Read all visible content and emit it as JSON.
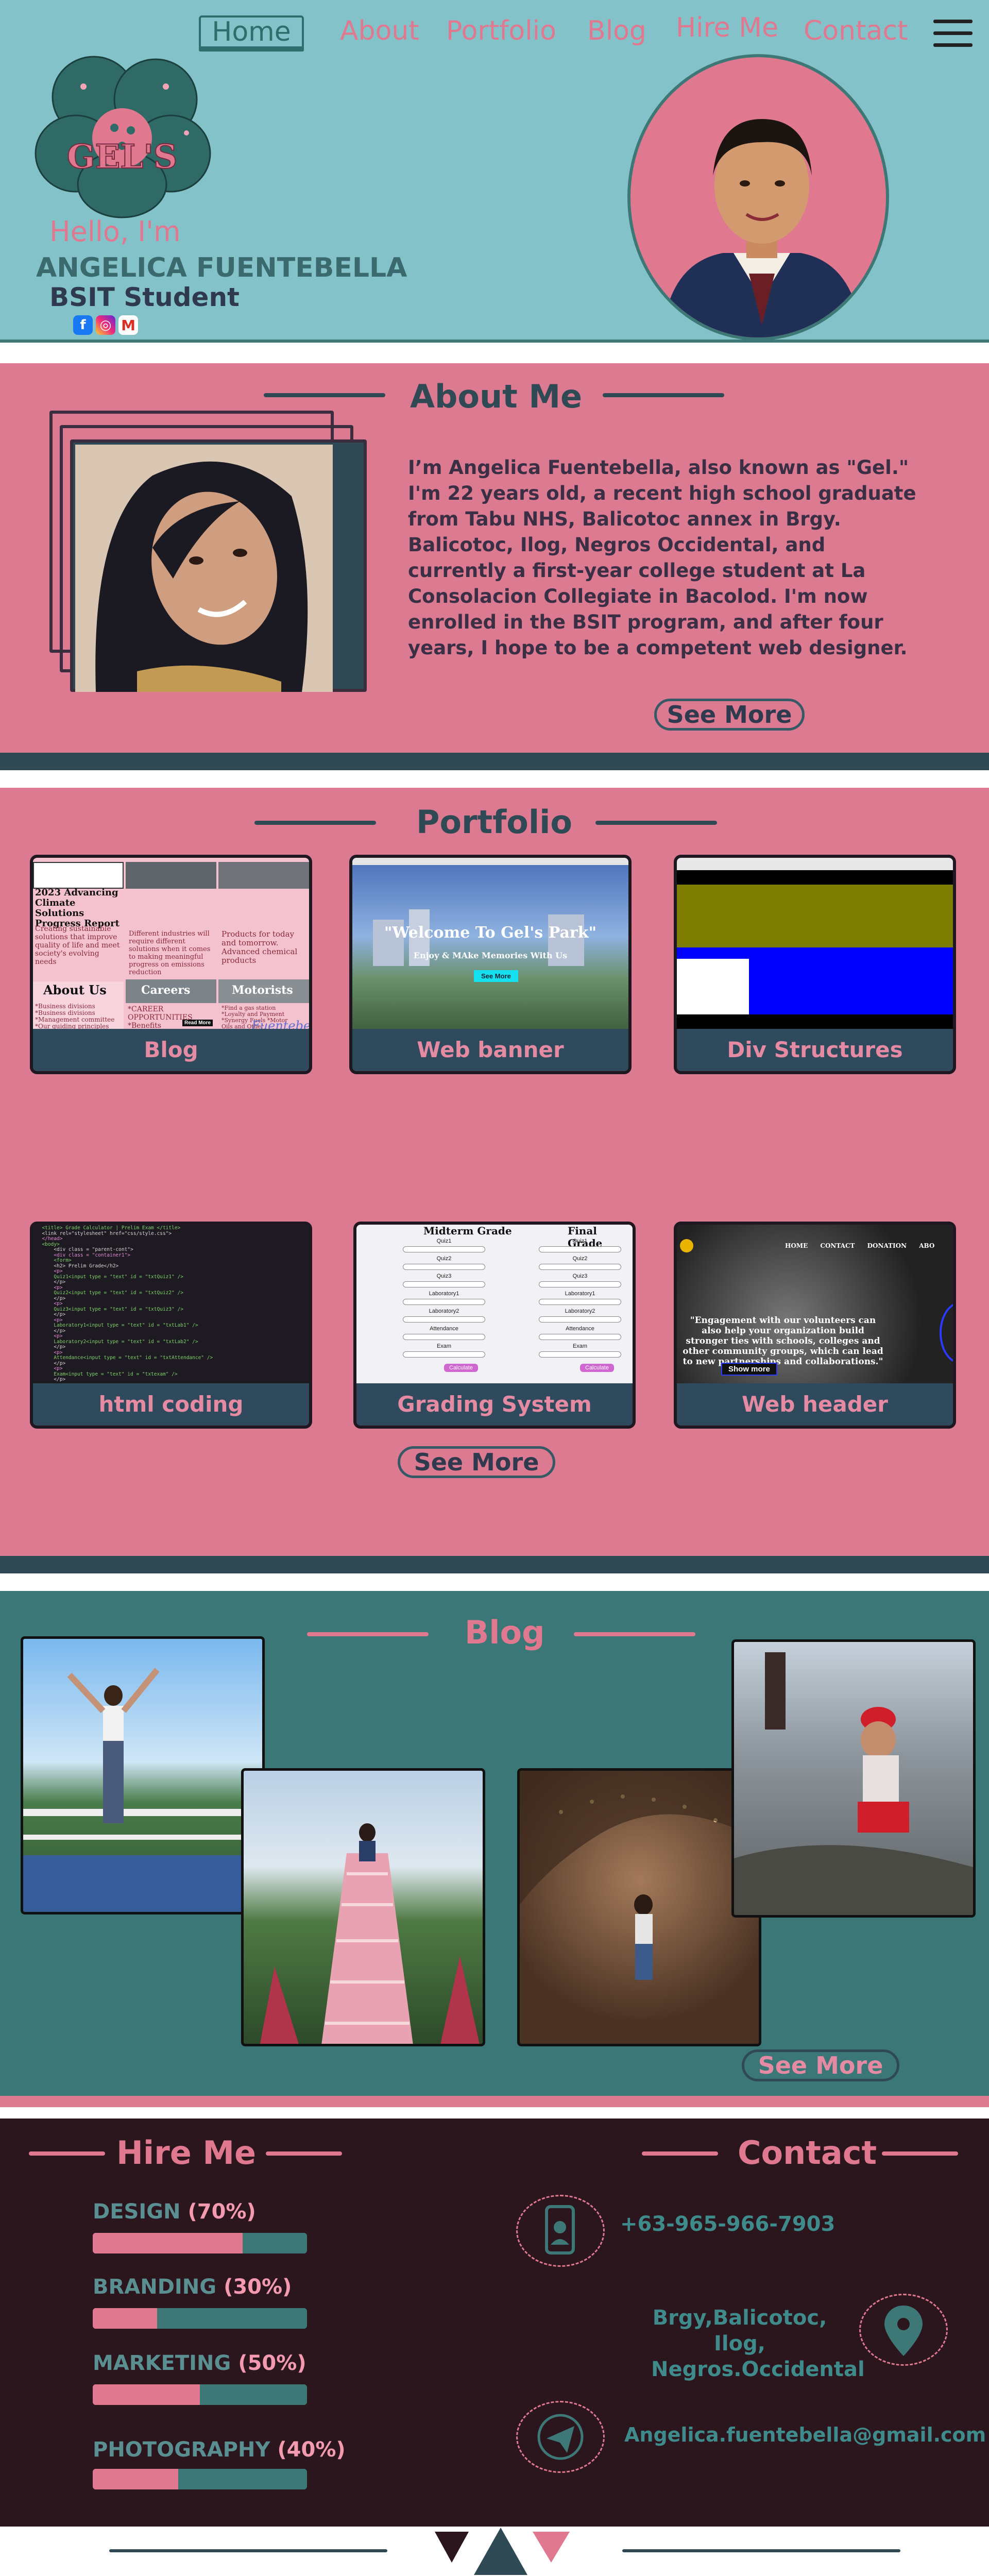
{
  "colors": {
    "hero_bg": "#84c2c9",
    "pink": "#dc7a91",
    "teal": "#3b7776",
    "dark": "#2b161e",
    "navy_strip": "#2f4a55"
  },
  "nav": {
    "home": "Home",
    "about": "About",
    "portfolio": "Portfolio",
    "blog": "Blog",
    "hire_me": "Hire Me",
    "contact": "Contact",
    "menu_icon": "hamburger-menu-icon"
  },
  "hero": {
    "logo_text": "GEL'S",
    "greeting": "Hello, I'm",
    "name": "ANGELICA FUENTEBELLA",
    "role": "BSIT Student",
    "social_icons": [
      "facebook-icon",
      "instagram-icon",
      "gmail-icon"
    ],
    "portrait_icon": "profile-portrait"
  },
  "about": {
    "title": "About Me",
    "text": "I’m Angelica Fuentebella, also known as \"Gel.\" I'm 22 years old, a recent high school graduate from Tabu NHS, Balicotoc annex in Brgy. Balicotoc, Ilog, Negros Occidental, and currently a first-year college student at La Consolacion Collegiate in Bacolod. I'm now enrolled in the BSIT program, and after four years, I hope to be a competent web designer.",
    "see_more": "See More"
  },
  "portfolio": {
    "title": "Portfolio",
    "items": [
      {
        "label": "Blog"
      },
      {
        "label": "Web banner"
      },
      {
        "label": "Div Structures"
      },
      {
        "label": "html coding"
      },
      {
        "label": "Grading System"
      },
      {
        "label": "Web header"
      }
    ],
    "see_more": "See More",
    "blog_thumb": {
      "col1_heading": "2023 Advancing Climate Solutions Progress Report",
      "col1_text": "Creating sustainable solutions that improve quality of life and meet society's evolving needs",
      "col2_text": "Different industries will require different solutions when it comes to making meaningful progress on emissions reduction",
      "col3_text": "Products for today and tomorrow. Advanced chemical products",
      "about_heading": "About Us",
      "careers_heading": "Careers",
      "motorists_heading": "Motorists",
      "about_list": "*Business divisions *Business divisions *Management committee *Our guiding principles",
      "careers_list": "*CAREER OPPORTUNITIES *Benefits",
      "motorists_list": "*Find a gas station *Loyalty and Payment *Synergy Fuels *Motor Oils and Other Lubricants",
      "read_more": "Read More",
      "signature": "Fuentebella"
    },
    "banner_thumb": {
      "welcome": "\"Welcome To Gel's Park\"",
      "tagline": "Enjoy & MAke Memories With Us",
      "button": "See More"
    },
    "header_thumb": {
      "nav": [
        "HOME",
        "CONTACT",
        "DONATION",
        "ABO"
      ],
      "quote": "\"Engagement with our volunteers can also help your organization build stronger ties with schools, colleges and other community groups, which can lead to new partnerships and collaborations.\"",
      "button": "Show more"
    },
    "grading_thumb": {
      "midterm": "Midterm Grade",
      "final": "Final Grade",
      "fields": [
        "Quiz1",
        "Quiz2",
        "Quiz3",
        "Laboratory1",
        "Laboratory2",
        "Attendance",
        "Exam"
      ],
      "button": "Calculate"
    },
    "code_lines": [
      "<title> Grade Calculator | Prelim Exam </title>",
      "<link rel=\"stylesheet\" href=\"css/style.css\">",
      "</head>",
      "<body>",
      "<div class = \"parent-cont\">",
      "<div class = \"container1\">",
      "<form>",
      "<h2> Prelim Grade</h2>",
      "<p>",
      "Quiz1<input type = \"text\" id = \"txtQuiz1\" />",
      "</p>",
      "<p>",
      "Quiz2<input type = \"text\" id = \"txtQuiz2\" />",
      "</p>",
      "<p>",
      "Quiz3<input type = \"text\" id = \"txtQuiz3\" />",
      "</p>",
      "<p>",
      "Laboratory1<input type = \"text\" id = \"txtLab1\" />",
      "</p>",
      "<p>",
      "Laboratory2<input type = \"text\" id = \"txtLab2\" />",
      "</p>",
      "<p>",
      "Attendance<input type = \"text\" id = \"txtAttendance\" />",
      "</p>",
      "<p>",
      "Exam<input type = \"text\" id = \"txtexam\" />",
      "</p>"
    ]
  },
  "blog": {
    "title": "Blog",
    "see_more": "See More",
    "photos": [
      "photo-mountain-viewpoint",
      "photo-pink-stairway",
      "photo-cave",
      "photo-mudflat"
    ]
  },
  "hire_me": {
    "title": "Hire Me",
    "skills": [
      {
        "name": "DESIGN",
        "pct_label": "(70%)",
        "value": 70
      },
      {
        "name": "BRANDING",
        "pct_label": "(30%)",
        "value": 30
      },
      {
        "name": "MARKETING",
        "pct_label": "(50%)",
        "value": 50
      },
      {
        "name": "PHOTOGRAPHY",
        "pct_label": "(40%)",
        "value": 40
      }
    ]
  },
  "contact": {
    "title": "Contact",
    "phone": "+63-965-966-7903",
    "address_line1": "Brgy,Balicotoc, Ilog,",
    "address_line2": "Negros.Occidental",
    "email": "Angelica.fuentebella@gmail.com",
    "icons": [
      "phone-icon",
      "location-pin-icon",
      "send-icon"
    ]
  },
  "bottom": {
    "icons": [
      "dark-triangle-icon",
      "teal-triangle-icon",
      "pink-triangle-icon"
    ]
  }
}
